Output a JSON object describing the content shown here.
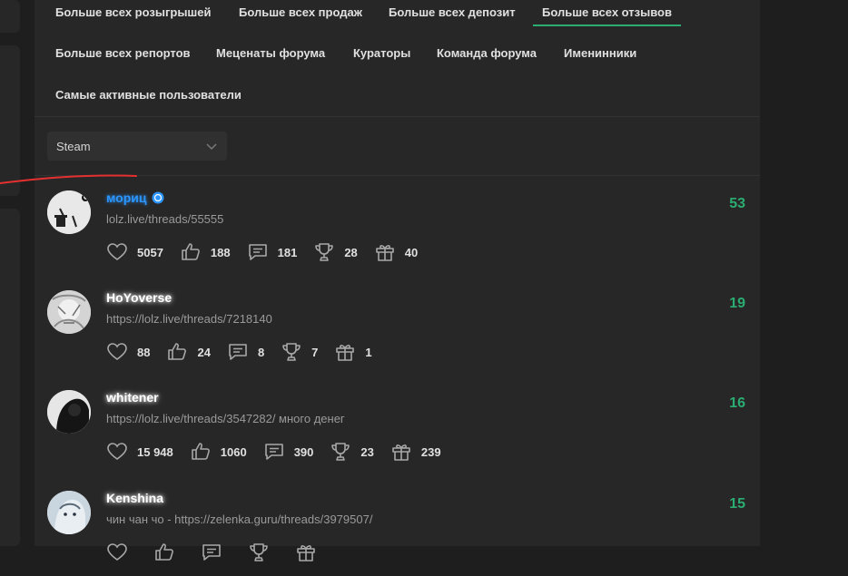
{
  "tabs": [
    {
      "label": "Больше всех розыгрышей",
      "active": false
    },
    {
      "label": "Больше всех продаж",
      "active": false
    },
    {
      "label": "Больше всех депозит",
      "active": false
    },
    {
      "label": "Больше всех отзывов",
      "active": true
    },
    {
      "label": "Больше всех репортов",
      "active": false
    },
    {
      "label": "Меценаты форума",
      "active": false
    },
    {
      "label": "Кураторы",
      "active": false
    },
    {
      "label": "Команда форума",
      "active": false
    },
    {
      "label": "Именинники",
      "active": false
    },
    {
      "label": "Самые активные пользователи",
      "active": false
    }
  ],
  "filter": {
    "selected": "Steam"
  },
  "colors": {
    "accent": "#2bad72",
    "background": "#1e1e1e",
    "panel": "#272727",
    "annotation": "#e53030"
  },
  "users": [
    {
      "name": "мориц",
      "verified": true,
      "status": "lolz.live/threads/55555",
      "count": "53",
      "stats": {
        "likes": "5057",
        "thumbs": "188",
        "messages": "181",
        "trophies": "28",
        "gifts": "40"
      }
    },
    {
      "name": "HoYoverse",
      "verified": false,
      "status": "https://lolz.live/threads/7218140",
      "count": "19",
      "stats": {
        "likes": "88",
        "thumbs": "24",
        "messages": "8",
        "trophies": "7",
        "gifts": "1"
      }
    },
    {
      "name": "whitener",
      "verified": false,
      "status": "https://lolz.live/threads/3547282/ много денег",
      "count": "16",
      "stats": {
        "likes": "15 948",
        "thumbs": "1060",
        "messages": "390",
        "trophies": "23",
        "gifts": "239"
      }
    },
    {
      "name": "Kenshina",
      "verified": false,
      "status": "чин чан чо - https://zelenka.guru/threads/3979507/",
      "count": "15",
      "stats": {
        "likes": "",
        "thumbs": "",
        "messages": "",
        "trophies": "",
        "gifts": ""
      }
    }
  ]
}
